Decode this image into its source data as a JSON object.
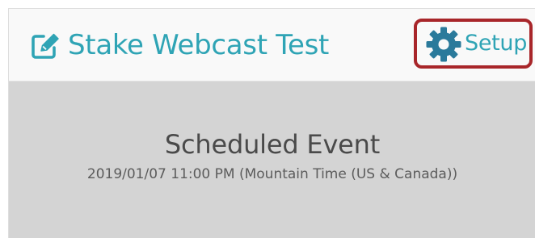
{
  "header": {
    "title": "Stake Webcast Test",
    "title_icon": "edit-icon",
    "setup_icon": "gear-icon",
    "setup_label": "Setup"
  },
  "event": {
    "status": "Scheduled Event",
    "datetime": "2019/01/07 11:00 PM (Mountain Time (US & Canada))"
  },
  "colors": {
    "accent": "#2fa4b5",
    "highlight_border": "#a8262a",
    "header_bg": "#f9f9f9",
    "event_bg": "#d4d4d4",
    "event_text": "#4a4a4a"
  }
}
